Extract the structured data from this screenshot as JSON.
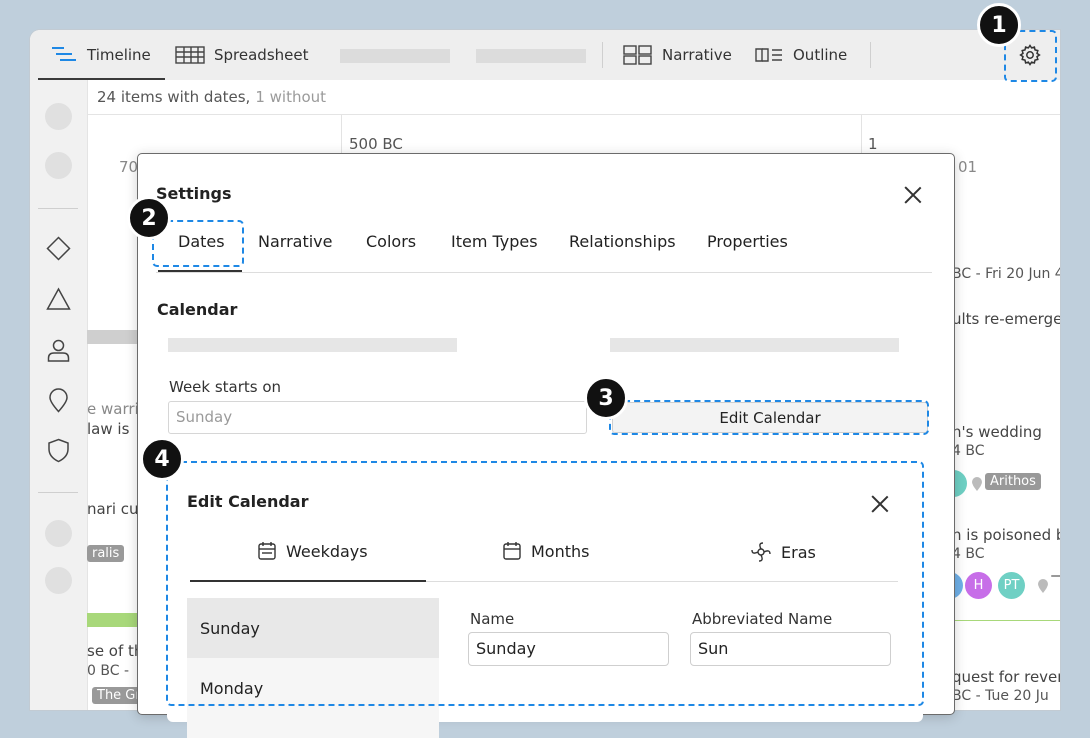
{
  "tabs": {
    "timeline": "Timeline",
    "spreadsheet": "Spreadsheet",
    "narrative": "Narrative",
    "outline": "Outline"
  },
  "info": {
    "with_dates": "24 items with dates,",
    "without": "1 without"
  },
  "timeline_bg": {
    "tick_70": "70",
    "tick_500bc": "500 BC",
    "tick_1": "1",
    "tick_01": "01",
    "date_right_1": "BC - Fri 20 Jun 4",
    "text_right_1": "ults re-emerge",
    "text_left_1a": "e warri",
    "text_left_1b": "law is",
    "text_right_2a": "n's wedding",
    "text_right_2b": "4 BC",
    "text_left_2": "nari cul",
    "tag_arithos": "Arithos",
    "tag_ralis": "ralis",
    "text_right_3a": "n is poisoned b",
    "text_right_3b": "4 BC",
    "avatar_h": "H",
    "avatar_pt": "PT",
    "text_left_3a": "se of th",
    "text_left_3b": "0 BC -",
    "tag_thegr": "The Gr",
    "text_right_4a": "quest for rever",
    "text_right_4b": "BC - Tue 20 Ju"
  },
  "settings": {
    "title": "Settings",
    "tabs": [
      "Dates",
      "Narrative",
      "Colors",
      "Item Types",
      "Relationships",
      "Properties"
    ],
    "section": "Calendar",
    "week_label": "Week starts on",
    "week_value": "Sunday",
    "edit_calendar_btn": "Edit Calendar"
  },
  "edit_calendar": {
    "title": "Edit Calendar",
    "tabs": {
      "weekdays": "Weekdays",
      "months": "Months",
      "eras": "Eras"
    },
    "days": [
      "Sunday",
      "Monday"
    ],
    "name_label": "Name",
    "name_value": "Sunday",
    "abbr_label": "Abbreviated Name",
    "abbr_value": "Sun"
  },
  "callouts": [
    "1",
    "2",
    "3",
    "4"
  ],
  "colors": {
    "callout_blue": "#1e88e5",
    "badge_black": "#111111",
    "avatar_teal": "#6fd0c4",
    "avatar_purple": "#c76ee8"
  }
}
